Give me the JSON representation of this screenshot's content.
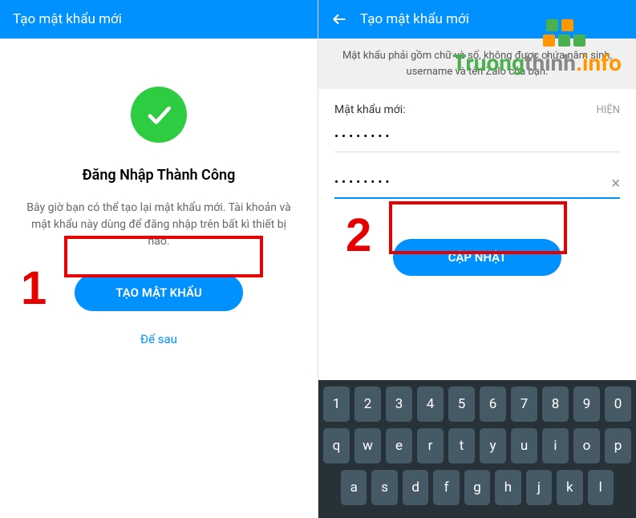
{
  "left": {
    "header_title": "Tạo mật khẩu mới",
    "success_title": "Đăng Nhập Thành Công",
    "success_desc": "Bây giờ bạn có thể tạo lại mật khẩu mới. Tài khoản và mật khẩu này dùng để đăng nhập trên bất kì thiết bị nào.",
    "create_button": "TẠO MẬT KHẨU",
    "skip_link": "Để sau",
    "step_number": "1"
  },
  "right": {
    "header_title": "Tạo mật khẩu mới",
    "hint": "Mật khẩu phải gồm chữ và số, không được chứa năm sinh, username và tên Zalo của bạn.",
    "field_label": "Mật khẩu mới:",
    "show_label": "HIỆN",
    "password1": "••••••••",
    "password2": "••••••••",
    "update_button": "CẬP NHẬT",
    "step_number": "2"
  },
  "keyboard": {
    "row1": [
      "1",
      "2",
      "3",
      "4",
      "5",
      "6",
      "7",
      "8",
      "9",
      "0"
    ],
    "row2": [
      "q",
      "w",
      "e",
      "r",
      "t",
      "y",
      "u",
      "i",
      "o",
      "p"
    ],
    "row3": [
      "a",
      "s",
      "d",
      "f",
      "g",
      "h",
      "j",
      "k",
      "l"
    ]
  },
  "watermark": {
    "brand1": "Truong",
    "brand2": "thinh",
    "brand3": ".info"
  }
}
